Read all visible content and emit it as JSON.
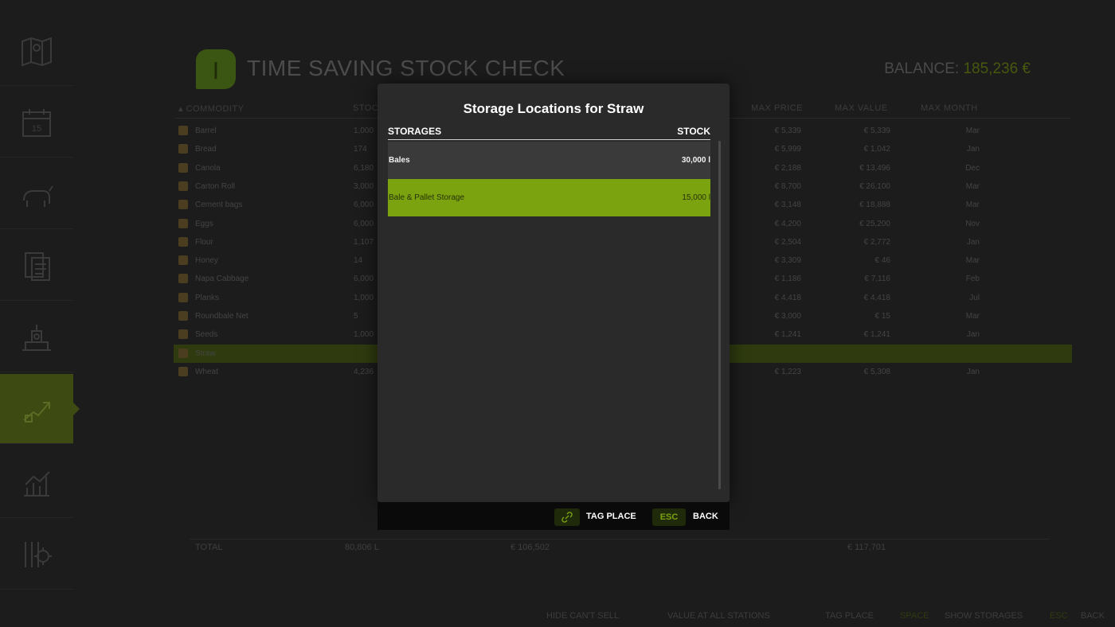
{
  "page": {
    "title": "TIME SAVING STOCK CHECK",
    "balance_label": "BALANCE:",
    "balance_value": "185,236 €"
  },
  "sidebar": {
    "items": [
      {
        "icon": "map-icon"
      },
      {
        "icon": "calendar-icon",
        "calendar_day": "15"
      },
      {
        "icon": "animals-icon"
      },
      {
        "icon": "contracts-icon"
      },
      {
        "icon": "production-icon"
      },
      {
        "icon": "stock-check-icon",
        "active": true
      },
      {
        "icon": "statistics-icon"
      },
      {
        "icon": "settings-icon"
      }
    ]
  },
  "table": {
    "headers": {
      "commodity": "COMMODITY",
      "stock": "STOC",
      "max_price": "MAX PRICE",
      "max_value": "MAX VALUE",
      "max_month": "MAX MONTH"
    },
    "rows": [
      {
        "name": "Barrel",
        "stock": "1,000",
        "max_price": "€ 5,339",
        "max_value": "€ 5,339",
        "max_month": "Mar"
      },
      {
        "name": "Bread",
        "stock": "174",
        "max_price": "€ 5,999",
        "max_value": "€ 1,042",
        "max_month": "Jan"
      },
      {
        "name": "Canola",
        "stock": "6,180",
        "max_price": "€ 2,188",
        "max_value": "€ 13,496",
        "max_month": "Dec"
      },
      {
        "name": "Carton Roll",
        "stock": "3,000",
        "max_price": "€ 8,700",
        "max_value": "€ 26,100",
        "max_month": "Mar"
      },
      {
        "name": "Cement bags",
        "stock": "6,000",
        "max_price": "€ 3,148",
        "max_value": "€ 18,888",
        "max_month": "Mar"
      },
      {
        "name": "Eggs",
        "stock": "6,000",
        "max_price": "€ 4,200",
        "max_value": "€ 25,200",
        "max_month": "Nov"
      },
      {
        "name": "Flour",
        "stock": "1,107",
        "max_price": "€ 2,504",
        "max_value": "€ 2,772",
        "max_month": "Jan"
      },
      {
        "name": "Honey",
        "stock": "14",
        "max_price": "€ 3,309",
        "max_value": "€ 46",
        "max_month": "Mar"
      },
      {
        "name": "Napa Cabbage",
        "stock": "6,000",
        "max_price": "€ 1,186",
        "max_value": "€ 7,116",
        "max_month": "Feb"
      },
      {
        "name": "Planks",
        "stock": "1,000",
        "max_price": "€ 4,418",
        "max_value": "€ 4,418",
        "max_month": "Jul"
      },
      {
        "name": "Roundbale Net",
        "stock": "5",
        "max_price": "€ 3,000",
        "max_value": "€ 15",
        "max_month": "Mar"
      },
      {
        "name": "Seeds",
        "stock": "1,000",
        "max_price": "€ 1,241",
        "max_value": "€ 1,241",
        "max_month": "Jan"
      },
      {
        "name": "Straw",
        "stock": "",
        "max_price": "",
        "max_value": "",
        "max_month": "",
        "selected": true
      },
      {
        "name": "Wheat",
        "stock": "4,236",
        "max_price": "€ 1,223",
        "max_value": "€ 5,308",
        "max_month": "Jan"
      }
    ],
    "total_label": "TOTAL",
    "total_stock": "80,806 L",
    "total_value_1": "€ 106,502",
    "total_value_2": "€ 117,701"
  },
  "bottom_bar": {
    "hide_cant_sell": "HIDE CAN'T SELL",
    "value_all_stations": "VALUE AT ALL STATIONS",
    "tag_place": "TAG PLACE",
    "space_key": "SPACE",
    "show_storages": "SHOW STORAGES",
    "esc_key": "ESC",
    "back": "BACK"
  },
  "modal": {
    "title": "Storage Locations for Straw",
    "col_storages": "STORAGES",
    "col_stock": "STOCK",
    "storages": [
      {
        "name": "Bales",
        "stock": "30,000 l",
        "active": false
      },
      {
        "name": "Bale & Pallet Storage",
        "stock": "15,000 l",
        "active": true
      }
    ],
    "footer": {
      "tag_place_label": "TAG PLACE",
      "esc_key": "ESC",
      "back_label": "BACK"
    }
  },
  "colors": {
    "accent": "#7ba30f",
    "modal_bg": "#2a2a2a",
    "page_bg": "#1c1c1c"
  }
}
